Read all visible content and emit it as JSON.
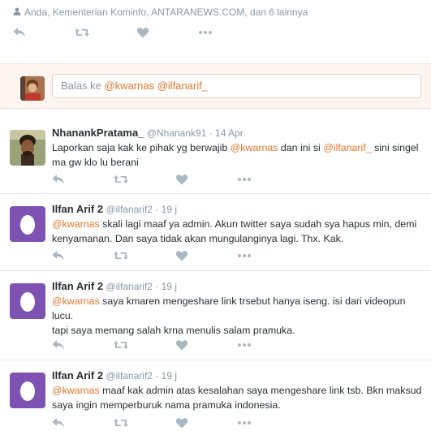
{
  "top": {
    "liked_by": "Anda, Kementerian Kominfo, ANTARANEWS.COM, dan 6 lainnya"
  },
  "reply": {
    "prefix": "Balas ke ",
    "mention1": "@kwarnas",
    "mention2": "@ilfanarif_"
  },
  "tweets": [
    {
      "name": "NhanankPratama_",
      "handle": "@Nhanank91",
      "sep": " · ",
      "time": "14 Apr",
      "t1": "Laporkan saja kak ke pihak yg berwajib ",
      "m1": "@kwarnas",
      "t2": " dan ini si ",
      "m2": "@ilfanarif_",
      "t3": " sini singel ma gw klo lu berani"
    },
    {
      "name": "Ilfan Arif 2",
      "handle": "@ilfanarif2",
      "sep": " · ",
      "time": "19 j",
      "m1": "@kwarnas",
      "t1": " skali lagi maaf ya admin. Akun twitter saya sudah sya hapus min, demi kenyamanan. Dan saya tidak akan mungulanginya lagi. Thx. Kak."
    },
    {
      "name": "Ilfan Arif 2",
      "handle": "@ilfanarif2",
      "sep": " · ",
      "time": "19 j",
      "m1": "@kwarnas",
      "t1": " saya kmaren mengeshare link trsebut hanya iseng. isi dari videopun lucu.",
      "t2": "tapi saya memang salah krna menulis salam pramuka."
    },
    {
      "name": "Ilfan Arif 2",
      "handle": "@ilfanarif2",
      "sep": " · ",
      "time": "19 j",
      "m1": "@kwarnas",
      "t1": " maaf kak admin atas kesalahan saya mengeshare link tsb. Bkn maksud saya ingin memperburuk nama pramuka indonesia."
    }
  ],
  "icons": {
    "reply": "reply-icon",
    "retweet": "retweet-icon",
    "like": "heart-icon",
    "more": "more-icon",
    "person": "person-icon"
  },
  "colors": {
    "accent": "#e4762c",
    "icon_gray": "#aab8c2",
    "egg_purple": "#7e52b3",
    "reply_bg": "#fff5f0"
  }
}
